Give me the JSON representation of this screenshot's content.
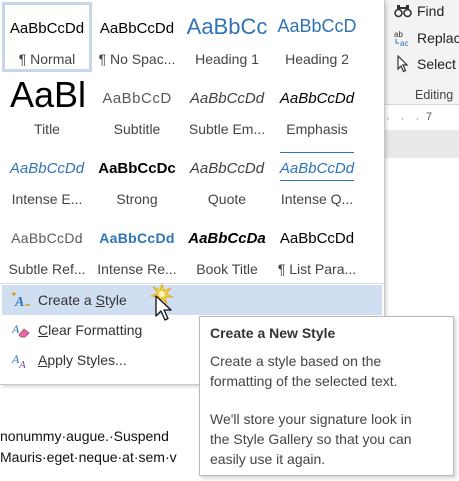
{
  "styles": [
    {
      "sample": "AaBbCcDd",
      "name": "¶ Normal"
    },
    {
      "sample": "AaBbCcDd",
      "name": "¶ No Spac..."
    },
    {
      "sample": "AaBbCc",
      "name": "Heading 1"
    },
    {
      "sample": "AaBbCcD",
      "name": "Heading 2"
    },
    {
      "sample": "AaBl",
      "name": "Title"
    },
    {
      "sample": "AaBbCcD",
      "name": "Subtitle"
    },
    {
      "sample": "AaBbCcDd",
      "name": "Subtle Em..."
    },
    {
      "sample": "AaBbCcDd",
      "name": "Emphasis"
    },
    {
      "sample": "AaBbCcDd",
      "name": "Intense E..."
    },
    {
      "sample": "AaBbCcDc",
      "name": "Strong"
    },
    {
      "sample": "AaBbCcDd",
      "name": "Quote"
    },
    {
      "sample": "AaBbCcDd",
      "name": "Intense Q..."
    },
    {
      "sample": "AaBbCcDd",
      "name": "Subtle Ref..."
    },
    {
      "sample": "AaBbCcDd",
      "name": "Intense Re..."
    },
    {
      "sample": "AaBbCcDa",
      "name": "Book Title"
    },
    {
      "sample": "AaBbCcDd",
      "name": "¶ List Para..."
    }
  ],
  "menu": {
    "create": {
      "pre": "Create a ",
      "u": "S",
      "post": "tyle"
    },
    "clear": {
      "pre": "",
      "u": "C",
      "post": "lear Formatting"
    },
    "apply": {
      "pre": "",
      "u": "A",
      "post": "pply Styles..."
    }
  },
  "tooltip": {
    "title": "Create a New Style",
    "line1": "Create a style based on the",
    "line2": "formatting of the selected text.",
    "line3": "We'll store your signature look in",
    "line4": "the Style Gallery so that you can",
    "line5": "easily use it again."
  },
  "ribbon": {
    "find": "Find",
    "replace": "Replac",
    "select": "Select",
    "group_label": "Editing",
    "ruler_dots": "· · ·",
    "ruler_num": "7"
  },
  "document": {
    "line1": "nonummy·augue.·Suspend",
    "line2": "Mauris·eget·neque·at·sem·v"
  },
  "colors": {
    "accent_blue": "#2e74b5",
    "hover_bg": "#cfdef1",
    "selected_border": "#c7d6ea"
  }
}
